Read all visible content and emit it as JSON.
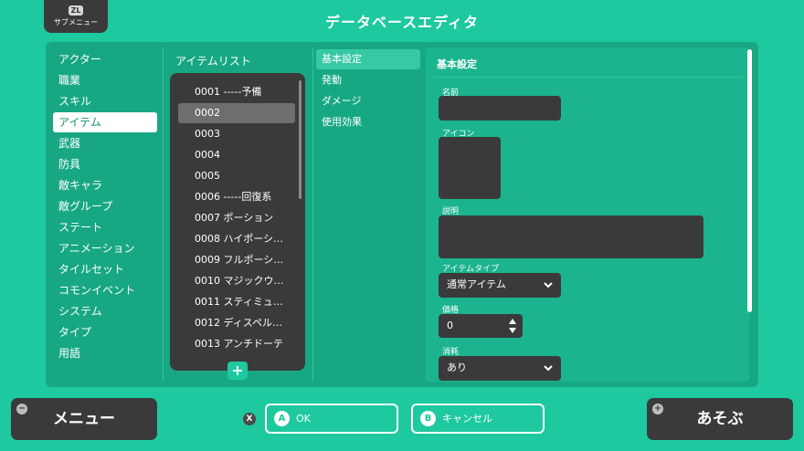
{
  "header": {
    "submenu_key": "ZL",
    "submenu_label": "サブメニュー",
    "title": "データベースエディタ"
  },
  "categories": [
    {
      "label": "アクター"
    },
    {
      "label": "職業"
    },
    {
      "label": "スキル"
    },
    {
      "label": "アイテム",
      "selected": true
    },
    {
      "label": "武器"
    },
    {
      "label": "防具"
    },
    {
      "label": "敵キャラ"
    },
    {
      "label": "敵グループ"
    },
    {
      "label": "ステート"
    },
    {
      "label": "アニメーション"
    },
    {
      "label": "タイルセット"
    },
    {
      "label": "コモンイベント"
    },
    {
      "label": "システム"
    },
    {
      "label": "タイプ"
    },
    {
      "label": "用語"
    }
  ],
  "item_list": {
    "title": "アイテムリスト",
    "items": [
      {
        "label": "0001 -----予備"
      },
      {
        "label": "0002",
        "selected": true
      },
      {
        "label": "0003"
      },
      {
        "label": "0004"
      },
      {
        "label": "0005"
      },
      {
        "label": "0006 -----回復系"
      },
      {
        "label": "0007 ポーション"
      },
      {
        "label": "0008 ハイポーシ…"
      },
      {
        "label": "0009 フルポーシ…"
      },
      {
        "label": "0010 マジックウ…"
      },
      {
        "label": "0011 スティミュ…"
      },
      {
        "label": "0012 ディスペル…"
      },
      {
        "label": "0013 アンチドーテ"
      }
    ],
    "add_label": "+"
  },
  "tabs": [
    {
      "label": "基本設定",
      "selected": true
    },
    {
      "label": "発動"
    },
    {
      "label": "ダメージ"
    },
    {
      "label": "使用効果"
    }
  ],
  "settings": {
    "title": "基本設定",
    "name_label": "名前",
    "name_value": "",
    "icon_label": "アイコン",
    "description_label": "説明",
    "description_value": "",
    "item_type_label": "アイテムタイプ",
    "item_type_value": "通常アイテム",
    "price_label": "価格",
    "price_value": "0",
    "consume_label": "消耗",
    "consume_value": "あり"
  },
  "footer": {
    "menu_label": "メニュー",
    "menu_key": "−",
    "x_key": "X",
    "ok_key": "A",
    "ok_label": "OK",
    "cancel_key": "B",
    "cancel_label": "キャンセル",
    "play_label": "あそぶ",
    "play_key": "+"
  },
  "colors": {
    "background": "#1ec99f",
    "panel": "#17a883",
    "dark": "#3a3a3a",
    "selected_list_row": "#6e6e6e"
  }
}
